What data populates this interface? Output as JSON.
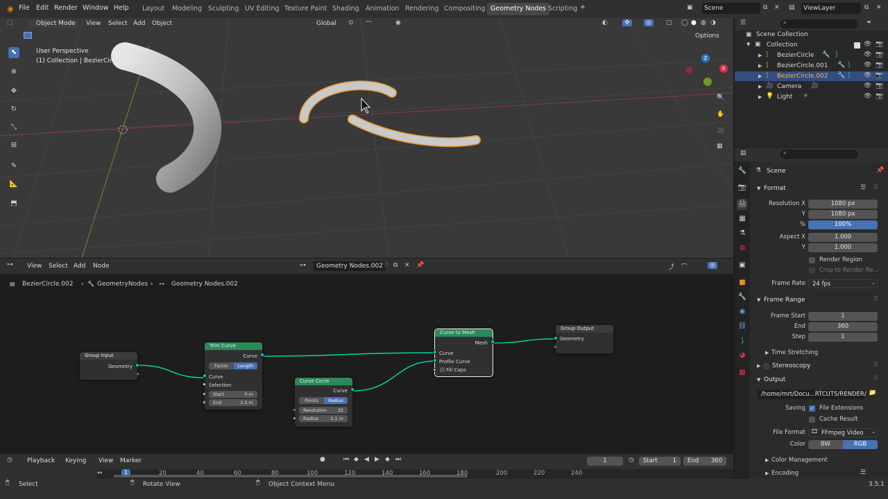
{
  "topbar": {
    "menus": [
      "File",
      "Edit",
      "Render",
      "Window",
      "Help"
    ],
    "workspaces": [
      "Layout",
      "Modeling",
      "Sculpting",
      "UV Editing",
      "Texture Paint",
      "Shading",
      "Animation",
      "Rendering",
      "Compositing",
      "Geometry Nodes",
      "Scripting"
    ],
    "active_workspace": "Geometry Nodes",
    "add_tab": "+",
    "scene": "Scene",
    "view_layer": "ViewLayer"
  },
  "viewport": {
    "mode": "Object Mode",
    "menus": [
      "View",
      "Select",
      "Add",
      "Object"
    ],
    "orientation": "Global",
    "options": "Options",
    "overlay_line1": "User Perspective",
    "overlay_line2": "(1) Collection | BezierCircle.002",
    "gizmo_axes": {
      "z": "Z",
      "x": "X"
    }
  },
  "node_editor": {
    "menus": [
      "View",
      "Select",
      "Add",
      "Node"
    ],
    "tree_name": "Geometry Nodes.002",
    "breadcrumb": [
      "BezierCircle.002",
      "GeometryNodes",
      "Geometry Nodes.002"
    ],
    "nodes": {
      "group_input": {
        "title": "Group Input",
        "geometry": "Geometry"
      },
      "trim_curve": {
        "title": "Trim Curve",
        "curve_out": "Curve",
        "mode_factor": "Factor",
        "mode_length": "Length",
        "curve_in": "Curve",
        "selection": "Selection",
        "start_label": "Start",
        "start_value": "0 m",
        "end_label": "End",
        "end_value": "2.5 m"
      },
      "curve_circle": {
        "title": "Curve Circle",
        "curve_out": "Curve",
        "mode_points": "Points",
        "mode_radius": "Radius",
        "resolution_label": "Resolution",
        "resolution_value": "32",
        "radius_label": "Radius",
        "radius_value": "0.1 m"
      },
      "curve_to_mesh": {
        "title": "Curve to Mesh",
        "mesh_out": "Mesh",
        "curve_in": "Curve",
        "profile_in": "Profile Curve",
        "fill_caps": "Fill Caps"
      },
      "group_output": {
        "title": "Group Output",
        "geometry": "Geometry"
      }
    }
  },
  "timeline": {
    "menus": [
      "Playback",
      "Keying",
      "View",
      "Marker"
    ],
    "current_frame": "1",
    "start_label": "Start",
    "start": "1",
    "end_label": "End",
    "end": "360",
    "ticks": [
      "20",
      "40",
      "60",
      "80",
      "100",
      "120",
      "140",
      "160",
      "180",
      "200",
      "220",
      "240"
    ],
    "ruler_current": "1"
  },
  "statusbar": {
    "select": "Select",
    "rotate": "Rotate View",
    "context": "Object Context Menu",
    "version": "3.5.1"
  },
  "outliner": {
    "root": "Scene Collection",
    "collection": "Collection",
    "items": [
      "BezierCircle",
      "BezierCircle.001",
      "BezierCircle.002",
      "Camera",
      "Light"
    ],
    "selected": "BezierCircle.002"
  },
  "properties": {
    "context": "Scene",
    "format_title": "Format",
    "resolution_x_label": "Resolution X",
    "resolution_x": "1080 px",
    "resolution_y_label": "Y",
    "resolution_y": "1080 px",
    "percent_label": "%",
    "percent": "100%",
    "aspect_x_label": "Aspect X",
    "aspect_x": "1.000",
    "aspect_y_label": "Y",
    "aspect_y": "1.000",
    "render_region": "Render Region",
    "crop": "Crop to Render Re...",
    "frame_rate_label": "Frame Rate",
    "frame_rate": "24 fps",
    "frame_range_title": "Frame Range",
    "frame_start_label": "Frame Start",
    "frame_start": "1",
    "end_label": "End",
    "end": "360",
    "step_label": "Step",
    "step": "1",
    "time_stretching": "Time Stretching",
    "stereoscopy": "Stereoscopy",
    "output_title": "Output",
    "output_path": "/home/mrt/Docu...RTCUTS/RENDER/",
    "saving_label": "Saving",
    "file_extensions": "File Extensions",
    "cache_result": "Cache Result",
    "file_format_label": "File Format",
    "file_format": "FFmpeg Video",
    "color_label": "Color",
    "color_bw": "BW",
    "color_rgb": "RGB",
    "color_management": "Color Management",
    "encoding": "Encoding"
  },
  "colors": {
    "accent": "#4772b3",
    "socket_geometry": "#00d6a3",
    "node_header_green": "#2a8a5a",
    "selection_orange": "#e8932f"
  }
}
